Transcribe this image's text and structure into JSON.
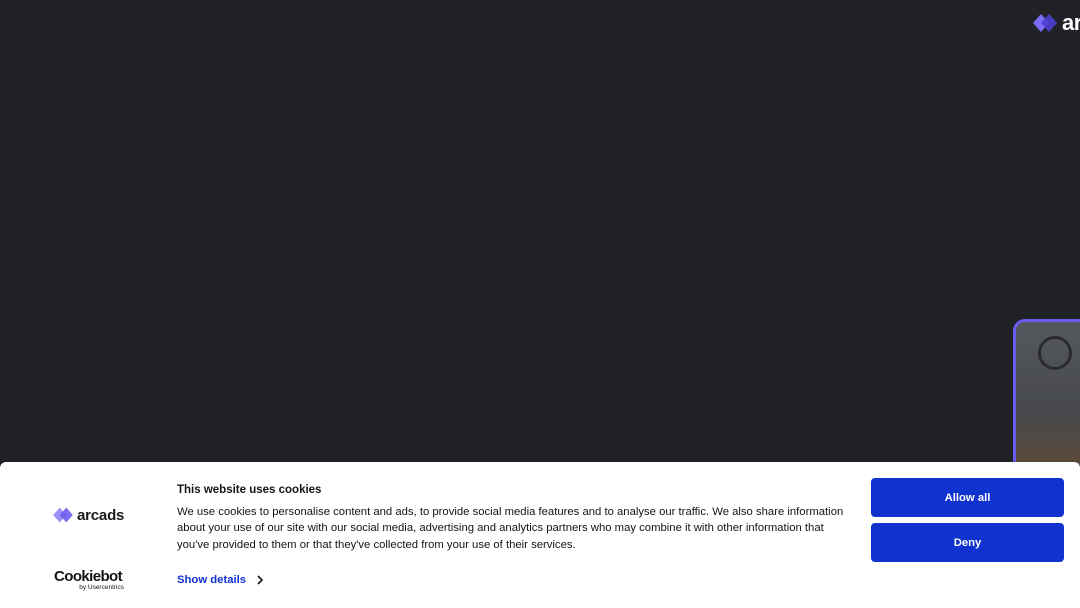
{
  "header": {
    "logo_text": "ar",
    "logo_icon": "arcads-diamond-icon"
  },
  "cookie_banner": {
    "title": "This website uses cookies",
    "description": "We use cookies to personalise content and ads, to provide social media features and to analyse our traffic. We also share information about your use of our site with our social media, advertising and analytics partners who may combine it with other information that you've provided to them or that they've collected from your use of their services.",
    "brand_logo_text": "arcads",
    "cookiebot_name": "Cookiebot",
    "cookiebot_sub": "by Usercentrics",
    "show_details_label": "Show details",
    "allow_all_label": "Allow all",
    "deny_label": "Deny"
  },
  "colors": {
    "background": "#202228",
    "accent": "#1032cf",
    "brand_purple": "#6a5cf0"
  }
}
